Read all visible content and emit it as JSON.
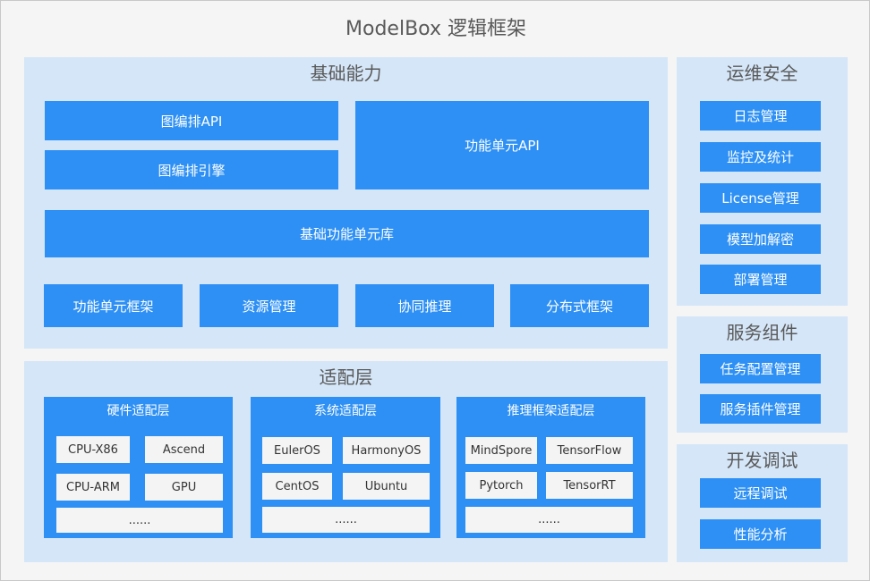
{
  "title": "ModelBox 逻辑框架",
  "basic": {
    "title": "基础能力",
    "graph_api": "图编排API",
    "graph_engine": "图编排引擎",
    "unit_api": "功能单元API",
    "unit_lib": "基础功能单元库",
    "unit_framework": "功能单元框架",
    "resource_mgmt": "资源管理",
    "co_inference": "协同推理",
    "distributed": "分布式框架"
  },
  "adapter": {
    "title": "适配层",
    "hardware": {
      "title": "硬件适配层",
      "items": [
        "CPU-X86",
        "Ascend",
        "CPU-ARM",
        "GPU"
      ],
      "more": "......"
    },
    "system": {
      "title": "系统适配层",
      "items": [
        "EulerOS",
        "HarmonyOS",
        "CentOS",
        "Ubuntu"
      ],
      "more": "......"
    },
    "inference": {
      "title": "推理框架适配层",
      "items": [
        "MindSpore",
        "TensorFlow",
        "Pytorch",
        "TensorRT"
      ],
      "more": "......"
    }
  },
  "ops": {
    "title": "运维安全",
    "items": [
      "日志管理",
      "监控及统计",
      "License管理",
      "模型加解密",
      "部署管理"
    ]
  },
  "service": {
    "title": "服务组件",
    "items": [
      "任务配置管理",
      "服务插件管理"
    ]
  },
  "dev": {
    "title": "开发调试",
    "items": [
      "远程调试",
      "性能分析"
    ]
  }
}
